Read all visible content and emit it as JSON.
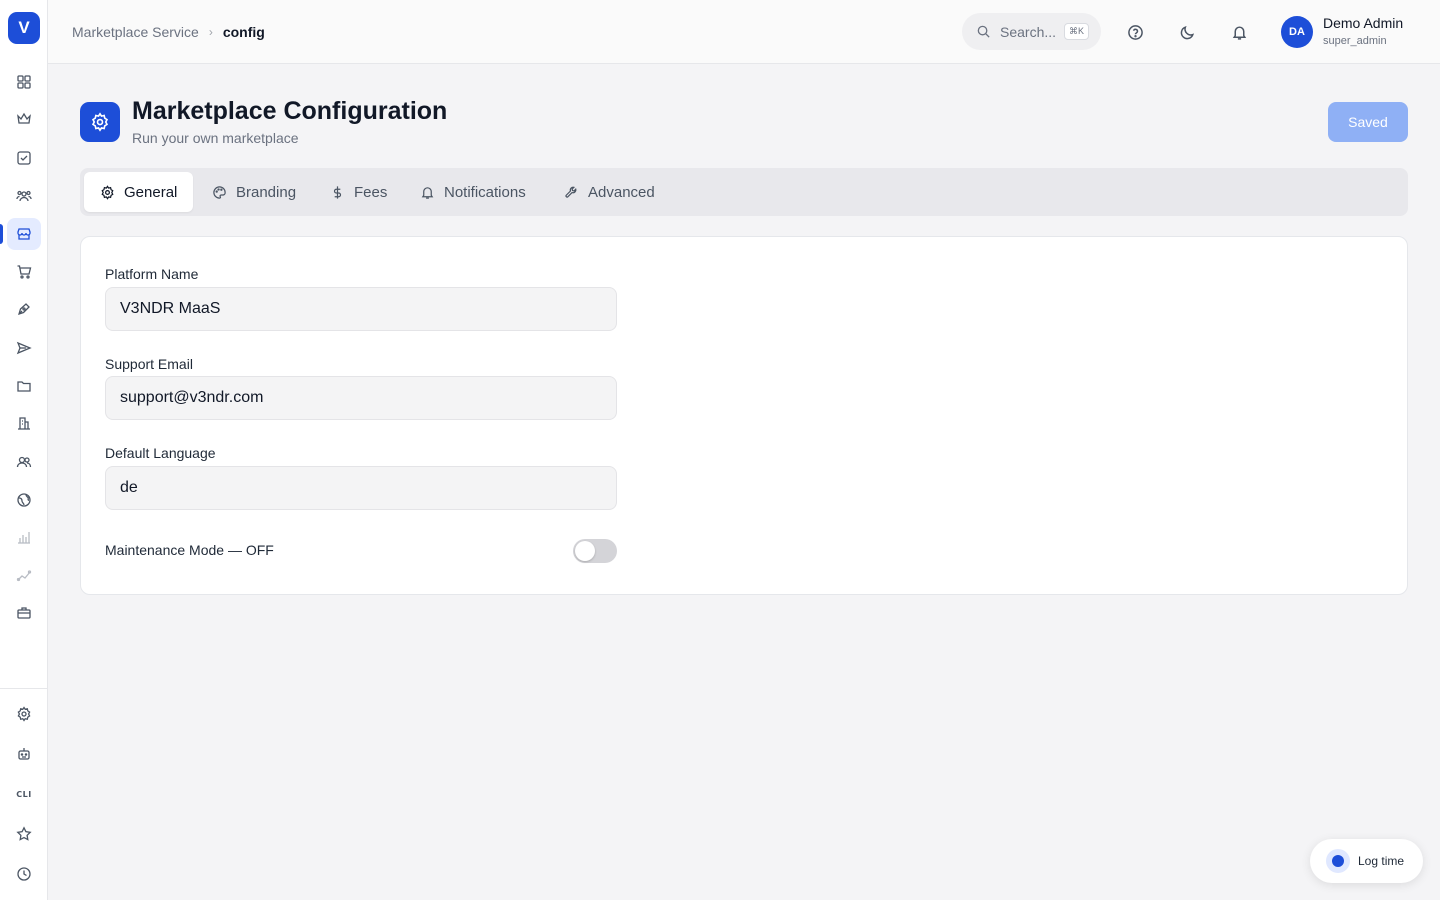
{
  "app": {
    "logo_letter": "V"
  },
  "breadcrumb": {
    "parent": "Marketplace Service",
    "current": "config"
  },
  "header": {
    "search_placeholder": "Search...",
    "search_shortcut": "⌘K",
    "user_initials": "DA",
    "user_name": "Demo Admin",
    "user_role": "super_admin"
  },
  "sidebar": {
    "items": [
      {
        "icon": "grid-icon"
      },
      {
        "icon": "crown-icon"
      },
      {
        "icon": "checkbox-icon"
      },
      {
        "icon": "users-group-icon"
      },
      {
        "icon": "store-icon",
        "active": true
      },
      {
        "icon": "cart-icon"
      },
      {
        "icon": "pen-icon"
      },
      {
        "icon": "send-icon"
      },
      {
        "icon": "folder-icon"
      },
      {
        "icon": "building-icon"
      },
      {
        "icon": "users-icon"
      },
      {
        "icon": "globe-icon"
      },
      {
        "icon": "bar-chart-icon"
      },
      {
        "icon": "trend-icon"
      },
      {
        "icon": "briefcase-icon"
      }
    ],
    "bottom": {
      "cli_label": "CLI"
    }
  },
  "page": {
    "title": "Marketplace Configuration",
    "subtitle": "Run your own marketplace",
    "save_label": "Saved"
  },
  "tabs": [
    {
      "label": "General",
      "icon": "gear-icon",
      "active": true
    },
    {
      "label": "Branding",
      "icon": "palette-icon"
    },
    {
      "label": "Fees",
      "icon": "dollar-icon"
    },
    {
      "label": "Notifications",
      "icon": "bell-icon"
    },
    {
      "label": "Advanced",
      "icon": "wrench-icon"
    }
  ],
  "form": {
    "platform_name_label": "Platform Name",
    "platform_name_value": "V3NDR MaaS",
    "support_email_label": "Support Email",
    "support_email_value": "support@v3ndr.com",
    "default_language_label": "Default Language",
    "default_language_value": "de",
    "maintenance_label": "Maintenance Mode — OFF",
    "maintenance_on": false
  },
  "log_time": {
    "label": "Log time"
  },
  "colors": {
    "accent": "#1d4ed8",
    "saved_button": "#8fb0f5"
  }
}
